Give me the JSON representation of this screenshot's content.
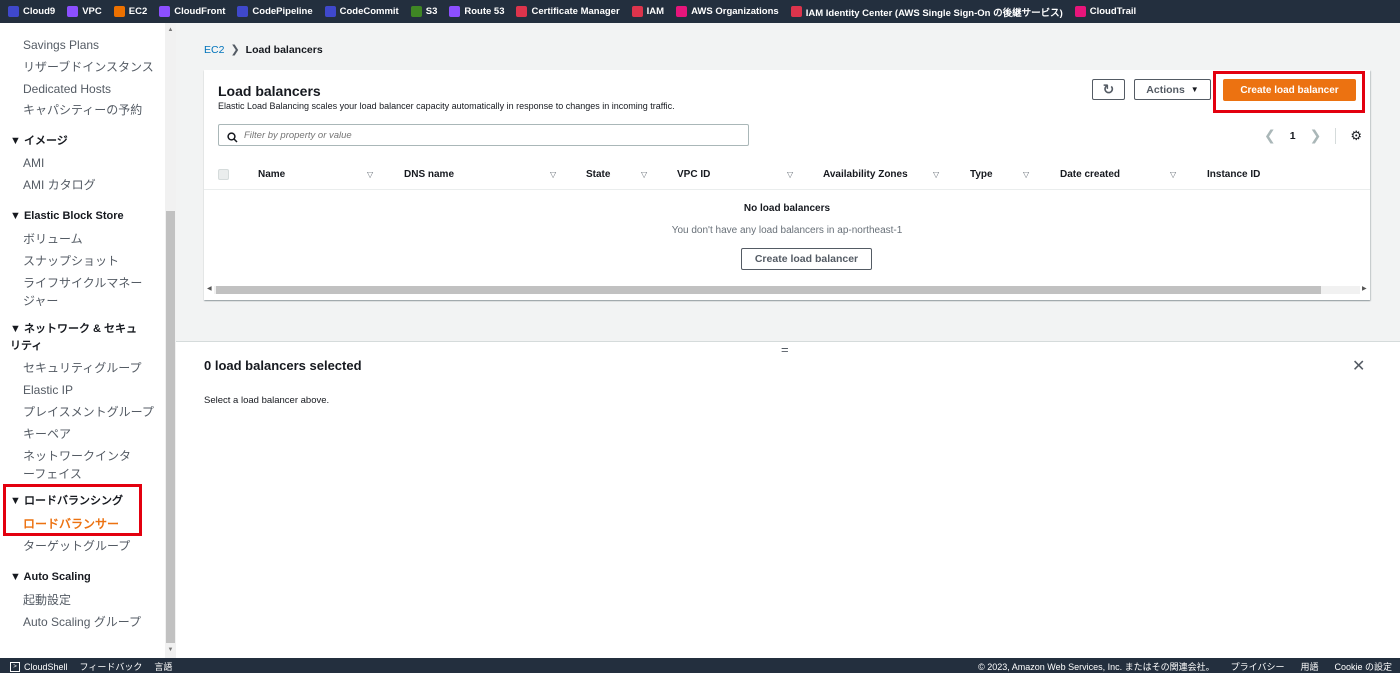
{
  "favorites": [
    {
      "label": "Cloud9",
      "color": "#3f48cc"
    },
    {
      "label": "VPC",
      "color": "#8c4fff"
    },
    {
      "label": "EC2",
      "color": "#ed7100"
    },
    {
      "label": "CloudFront",
      "color": "#8c4fff"
    },
    {
      "label": "CodePipeline",
      "color": "#3f48cc"
    },
    {
      "label": "CodeCommit",
      "color": "#3f48cc"
    },
    {
      "label": "S3",
      "color": "#3f8624"
    },
    {
      "label": "Route 53",
      "color": "#8c4fff"
    },
    {
      "label": "Certificate Manager",
      "color": "#dd344c"
    },
    {
      "label": "IAM",
      "color": "#dd344c"
    },
    {
      "label": "AWS Organizations",
      "color": "#e7157b"
    },
    {
      "label": "IAM Identity Center (AWS Single Sign-On の後継サービス)",
      "color": "#dd344c"
    },
    {
      "label": "CloudTrail",
      "color": "#e7157b"
    }
  ],
  "sidebar": {
    "items": {
      "savings_plans": "Savings Plans",
      "reserved": "リザーブドインスタンス",
      "dedicated_hosts": "Dedicated Hosts",
      "capacity": "キャパシティーの予約",
      "images_head": "▼ イメージ",
      "ami": "AMI",
      "ami_catalog": "AMI カタログ",
      "ebs_head": "▼ Elastic Block Store",
      "volumes": "ボリューム",
      "snapshots": "スナップショット",
      "lifecycle": "ライフサイクルマネージャー",
      "network_head": "▼ ネットワーク & セキュリティ",
      "security_groups": "セキュリティグループ",
      "elastic_ip": "Elastic IP",
      "placement": "プレイスメントグループ",
      "keypair": "キーペア",
      "eni": "ネットワークインターフェイス",
      "lb_head": "▼ ロードバランシング",
      "load_balancers": "ロードバランサー",
      "target_groups": "ターゲットグループ",
      "as_head": "▼ Auto Scaling",
      "launch_config": "起動設定",
      "as_groups": "Auto Scaling グループ"
    }
  },
  "breadcrumb": {
    "root": "EC2",
    "current": "Load balancers"
  },
  "panel": {
    "title": "Load balancers",
    "description": "Elastic Load Balancing scales your load balancer capacity automatically in response to changes in incoming traffic.",
    "actions_label": "Actions",
    "create_label": "Create load balancer",
    "filter_placeholder": "Filter by property or value",
    "page": "1"
  },
  "table": {
    "columns": [
      "Name",
      "DNS name",
      "State",
      "VPC ID",
      "Availability Zones",
      "Type",
      "Date created",
      "Instance ID"
    ],
    "empty_title": "No load balancers",
    "empty_desc": "You don't have any load balancers in ap-northeast-1",
    "empty_button": "Create load balancer"
  },
  "split": {
    "title": "0 load balancers selected",
    "desc": "Select a load balancer above.",
    "handle": "="
  },
  "footer": {
    "cloudshell": "CloudShell",
    "feedback": "フィードバック",
    "language": "言語",
    "copyright": "© 2023, Amazon Web Services, Inc. またはその関連会社。",
    "privacy": "プライバシー",
    "terms": "用語",
    "cookie": "Cookie の設定"
  }
}
